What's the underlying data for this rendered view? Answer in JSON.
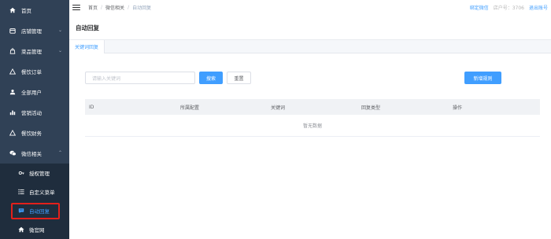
{
  "sidebar": {
    "items": [
      {
        "label": "首页",
        "icon": "home-icon"
      },
      {
        "label": "店铺管理",
        "icon": "shop-icon",
        "expandable": true
      },
      {
        "label": "菜品管理",
        "icon": "bag-icon",
        "expandable": true
      },
      {
        "label": "餐饮订单",
        "icon": "triangle-icon"
      },
      {
        "label": "全部用户",
        "icon": "users-icon"
      },
      {
        "label": "营销活动",
        "icon": "chart-icon"
      },
      {
        "label": "餐饮财务",
        "icon": "triangle-icon"
      },
      {
        "label": "微信相关",
        "icon": "wechat-icon",
        "expandable": true,
        "expanded": true
      }
    ],
    "sub_items": [
      {
        "label": "授权管理",
        "icon": "auth-icon"
      },
      {
        "label": "自定义菜单",
        "icon": "list-icon"
      },
      {
        "label": "自动回复",
        "icon": "message-icon",
        "active": true
      },
      {
        "label": "微官网",
        "icon": "home-icon"
      }
    ]
  },
  "topbar": {
    "breadcrumb": [
      "首页",
      "微信相关",
      "自动回复"
    ],
    "bind_wechat": "绑定微信",
    "shop_id": "店户号：3706",
    "logout": "退出账号"
  },
  "page": {
    "title": "自动回复",
    "tabs": [
      {
        "label": "关键词回复",
        "active": true
      }
    ]
  },
  "search": {
    "placeholder": "请输入关键词",
    "search_label": "搜索",
    "reset_label": "重置",
    "new_label": "新增规则"
  },
  "table": {
    "columns": [
      "ID",
      "所属配置",
      "关键词",
      "回复类型",
      "操作"
    ],
    "empty_text": "暂无数据"
  },
  "colors": {
    "sidebar_bg": "#304156",
    "submenu_bg": "#1f2d3d",
    "accent": "#409eff",
    "highlight": "#e3201b"
  }
}
